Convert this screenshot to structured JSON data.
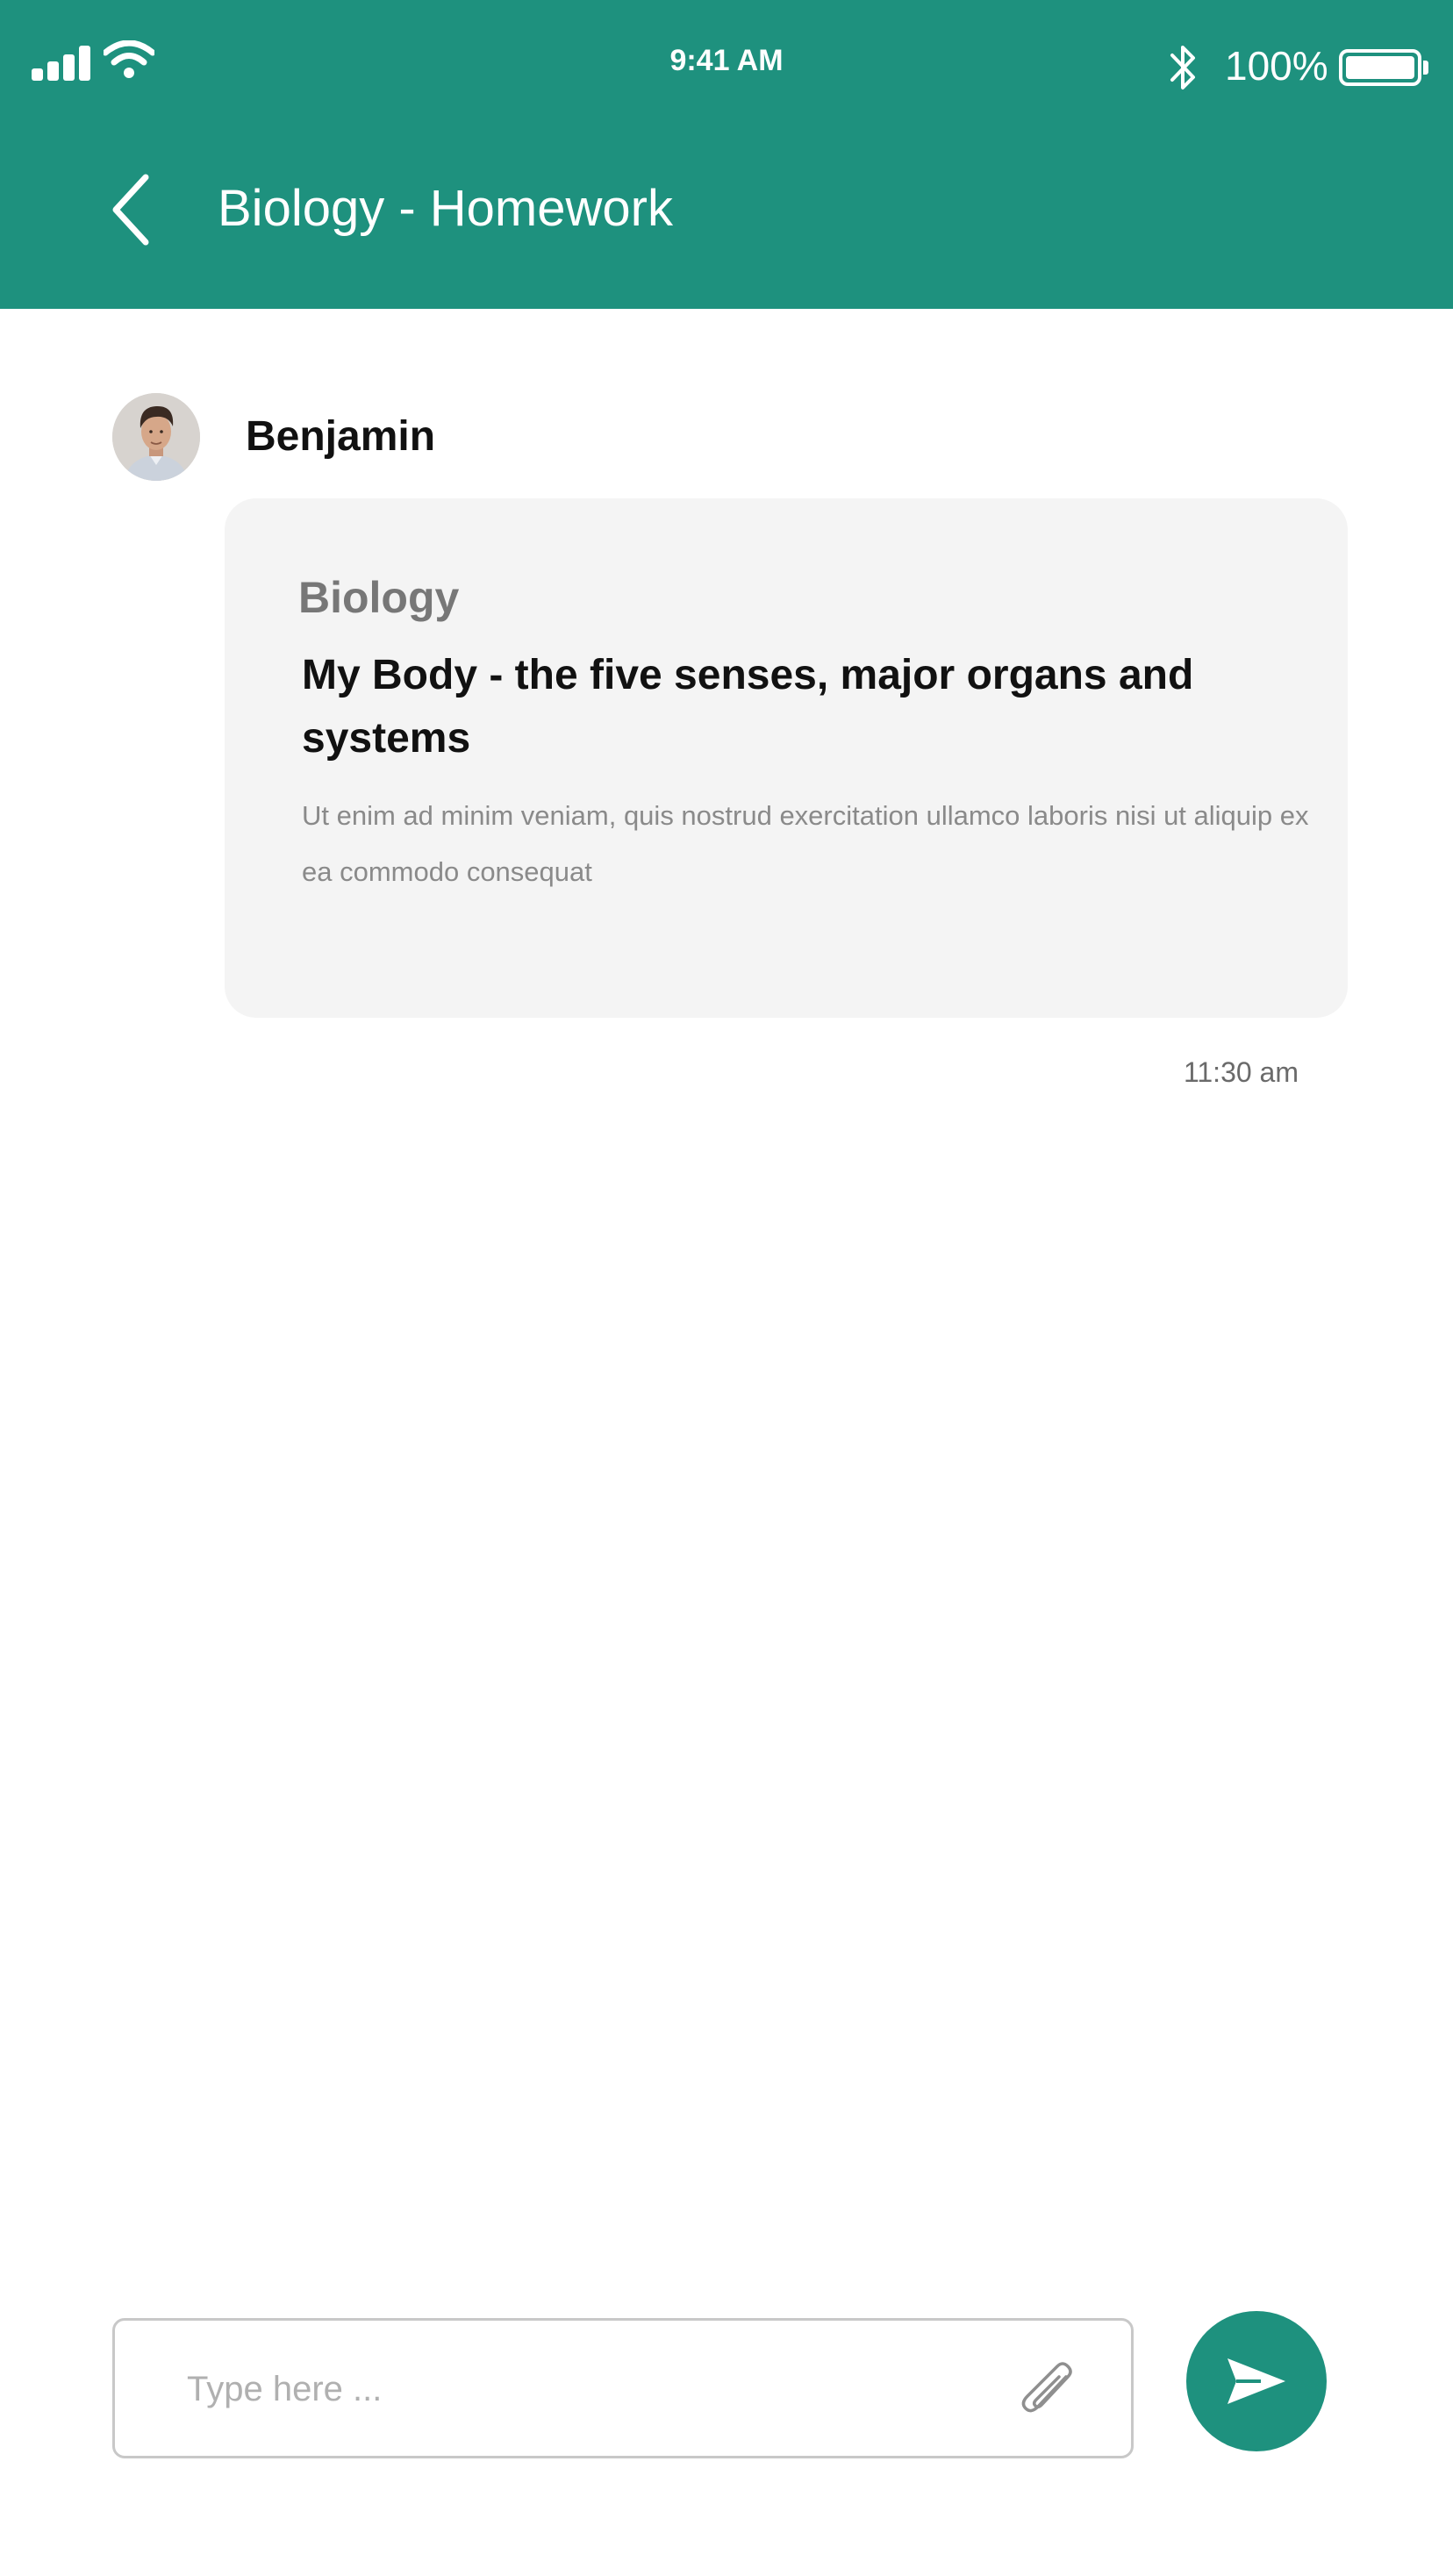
{
  "status_bar": {
    "time": "9:41 AM",
    "battery_percent": "100%",
    "battery_level": 1.0
  },
  "header": {
    "title": "Biology - Homework",
    "back_icon": "chevron-left-icon"
  },
  "message": {
    "sender": "Benjamin",
    "subject": "Biology",
    "title": "My Body - the five senses, major organs and systems",
    "body": "Ut enim ad minim veniam, quis nostrud exercitation ullamco laboris nisi ut aliquip ex ea commodo consequat",
    "time": "11:30 am"
  },
  "composer": {
    "placeholder": "Type here ...",
    "value": "",
    "attach_icon": "paperclip-icon",
    "send_icon": "send-icon"
  },
  "colors": {
    "accent": "#1e917e",
    "card_background": "#f4f4f4"
  }
}
